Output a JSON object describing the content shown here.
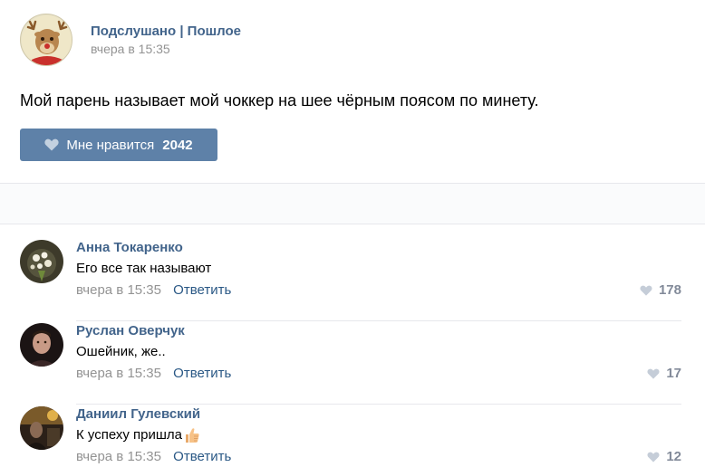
{
  "post": {
    "group_name": "Подслушано | Пошлое",
    "time": "вчера в 15:35",
    "text": "Мой парень называет мой чоккер на шее чёрным поясом по минету.",
    "like_label": "Мне нравится",
    "like_count": "2042",
    "avatar_icon": "reindeer-avatar"
  },
  "comments": [
    {
      "author": "Анна Токаренко",
      "text": "Его все так называют",
      "time": "вчера в 15:35",
      "reply_label": "Ответить",
      "likes": "178"
    },
    {
      "author": "Руслан Оверчук",
      "text": "Ошейник, же..",
      "time": "вчера в 15:35",
      "reply_label": "Ответить",
      "likes": "17"
    },
    {
      "author": "Даниил Гулевский",
      "text": "К успеху пришла",
      "time": "вчера в 15:35",
      "reply_label": "Ответить",
      "likes": "12",
      "emoji": "thumbs-up-emoji"
    }
  ],
  "colors": {
    "link": "#42648b",
    "reply": "#2a5885",
    "like_button": "#5e81a8",
    "muted": "#939393"
  }
}
